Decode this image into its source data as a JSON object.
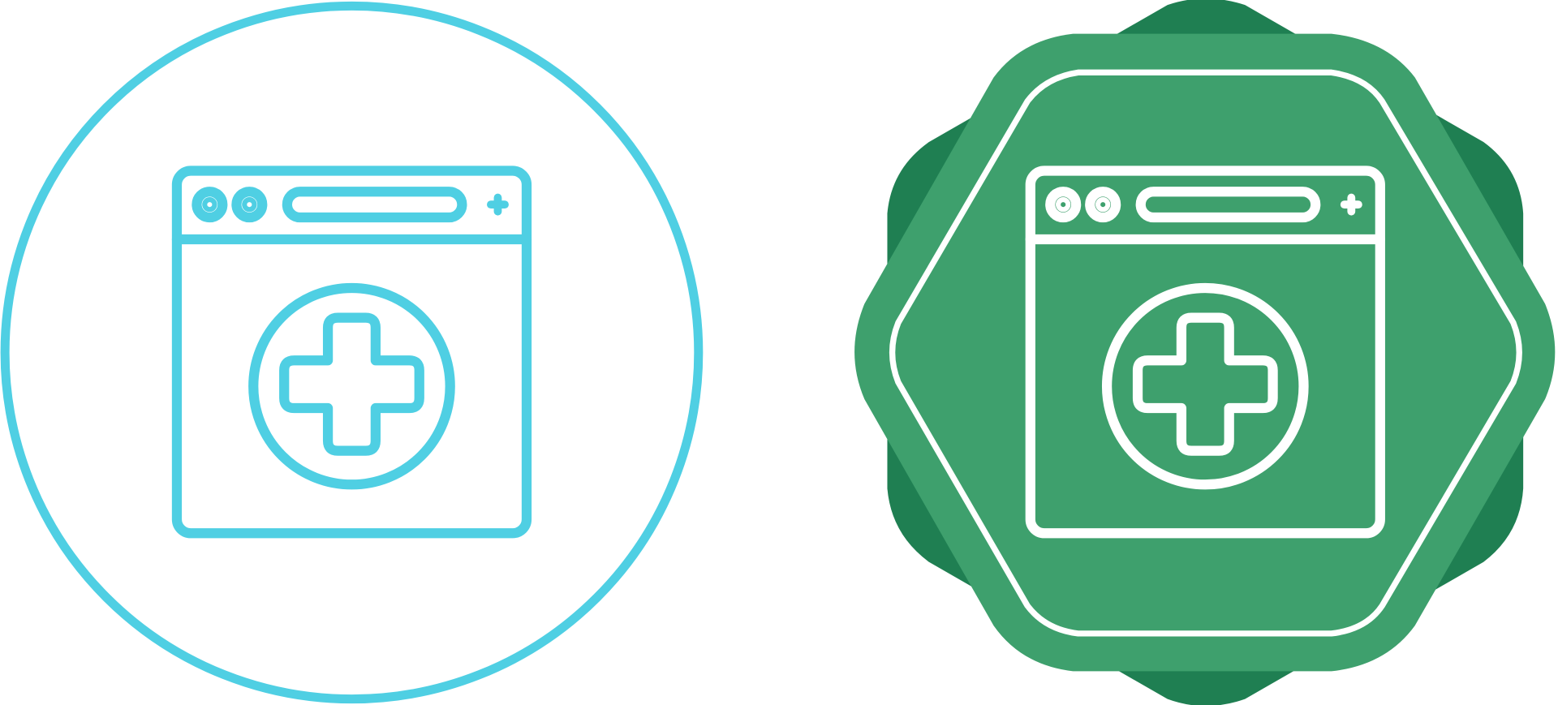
{
  "icon_set": [
    {
      "variant": "outline-circle",
      "icon": "medical-browser-icon",
      "colors": {
        "stroke": "#4fcfe3",
        "background": "#ffffff"
      }
    },
    {
      "variant": "badge-filled",
      "icon": "medical-browser-icon",
      "colors": {
        "badge_dark": "#1f7f52",
        "badge_light": "#3ea06d",
        "stroke": "#ffffff"
      }
    }
  ]
}
